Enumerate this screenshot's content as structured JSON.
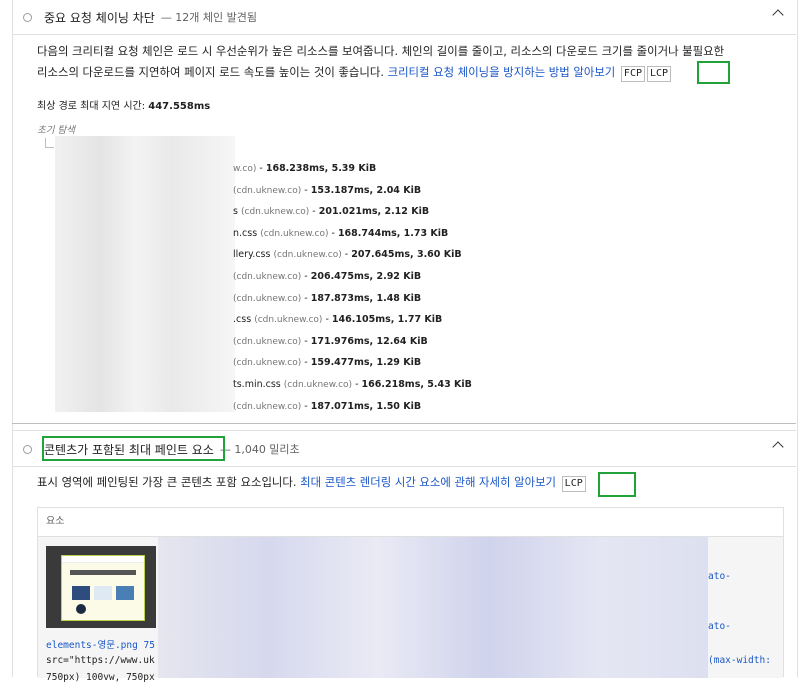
{
  "audit1": {
    "title": "중요 요청 체이닝 차단",
    "extra": "— 12개 체인 발견됨",
    "desc_line1": "다음의 크리티컬 요청 체인은 로드 시 우선순위가 높은 리소스를 보여줍니다. 체인의 길이를 줄이고, 리소스의 다운로드 크기를 줄이거나 불필요한",
    "desc_line2": "리소스의 다운로드를 지연하여 페이지 로드 속도를 높이는 것이 좋습니다. ",
    "link": "크리티컬 요청 체이닝을 방지하는 방법 알아보기",
    "chip_fcp": "FCP",
    "chip_lcp": "LCP",
    "latency_label": "최상 경로 최대 지연 시간: ",
    "latency_value": "447.558ms",
    "initial_nav": "초기 탐색",
    "chains": [
      {
        "name": "",
        "host": "w.co)",
        "stat": "168.238ms, 5.39 KiB"
      },
      {
        "name": "",
        "host": "(cdn.uknew.co)",
        "stat": "153.187ms, 2.04 KiB"
      },
      {
        "name": "s",
        "host": "(cdn.uknew.co)",
        "stat": "201.021ms, 2.12 KiB"
      },
      {
        "name": "n.css",
        "host": "(cdn.uknew.co)",
        "stat": "168.744ms, 1.73 KiB"
      },
      {
        "name": "llery.css",
        "host": "(cdn.uknew.co)",
        "stat": "207.645ms, 3.60 KiB"
      },
      {
        "name": "",
        "host": "(cdn.uknew.co)",
        "stat": "206.475ms, 2.92 KiB"
      },
      {
        "name": "",
        "host": "(cdn.uknew.co)",
        "stat": "187.873ms, 1.48 KiB"
      },
      {
        "name": ".css",
        "host": "(cdn.uknew.co)",
        "stat": "146.105ms, 1.77 KiB"
      },
      {
        "name": "",
        "host": "(cdn.uknew.co)",
        "stat": "171.976ms, 12.64 KiB"
      },
      {
        "name": "",
        "host": "(cdn.uknew.co)",
        "stat": "159.477ms, 1.29 KiB"
      },
      {
        "name": "ts.min.css",
        "host": "(cdn.uknew.co)",
        "stat": "166.218ms, 5.43 KiB"
      },
      {
        "name": "",
        "host": "(cdn.uknew.co)",
        "stat": "187.071ms, 1.50 KiB"
      }
    ]
  },
  "audit2": {
    "title": "콘텐츠가 포함된 최대 페인트 요소",
    "extra": "— 1,040 밀리초",
    "desc": "표시 영역에 페인팅된 가장 큰 콘텐츠 포함 요소입니다. ",
    "link": "최대 콘텐츠 렌더링 시간 요소에 관해 자세히 알아보기",
    "chip_lcp": "LCP",
    "table_header": "요소",
    "code_right1": "ato-",
    "code_right2": "ato-",
    "code_right3": "(max-width:",
    "code_line1": "elements-영문.png 75",
    "code_line2": "src=\"https://www.uk",
    "code_line3": "750px) 100vw, 750px"
  }
}
